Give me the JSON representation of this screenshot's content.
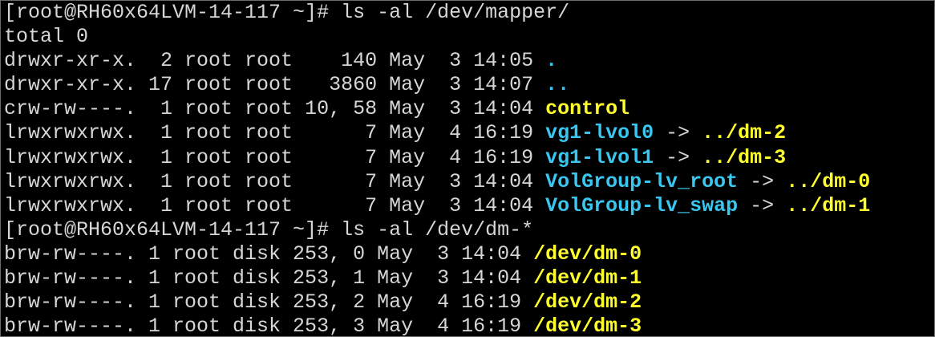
{
  "terminal": {
    "colors": {
      "background": "#000000",
      "text": "#d6d6d6",
      "cyan": "#39c7f0",
      "yellow": "#ffff2e"
    },
    "lines": [
      [
        {
          "text": "[root@RH60x64LVM-14-117 ~]# ls -al /dev/mapper/",
          "color": "default"
        }
      ],
      [
        {
          "text": "total 0",
          "color": "default"
        }
      ],
      [
        {
          "text": "drwxr-xr-x.  2 root root    140 May  3 14:05 ",
          "color": "default"
        },
        {
          "text": ".",
          "color": "cyan"
        }
      ],
      [
        {
          "text": "drwxr-xr-x. 17 root root   3860 May  3 14:07 ",
          "color": "default"
        },
        {
          "text": "..",
          "color": "cyan"
        }
      ],
      [
        {
          "text": "crw-rw----.  1 root root 10, 58 May  3 14:04 ",
          "color": "default"
        },
        {
          "text": "control",
          "color": "yellow"
        }
      ],
      [
        {
          "text": "lrwxrwxrwx.  1 root root      7 May  4 16:19 ",
          "color": "default"
        },
        {
          "text": "vg1-lvol0",
          "color": "cyan"
        },
        {
          "text": " -> ",
          "color": "default"
        },
        {
          "text": "../dm-2",
          "color": "yellow"
        }
      ],
      [
        {
          "text": "lrwxrwxrwx.  1 root root      7 May  4 16:19 ",
          "color": "default"
        },
        {
          "text": "vg1-lvol1",
          "color": "cyan"
        },
        {
          "text": " -> ",
          "color": "default"
        },
        {
          "text": "../dm-3",
          "color": "yellow"
        }
      ],
      [
        {
          "text": "lrwxrwxrwx.  1 root root      7 May  3 14:04 ",
          "color": "default"
        },
        {
          "text": "VolGroup-lv_root",
          "color": "cyan"
        },
        {
          "text": " -> ",
          "color": "default"
        },
        {
          "text": "../dm-0",
          "color": "yellow"
        }
      ],
      [
        {
          "text": "lrwxrwxrwx.  1 root root      7 May  3 14:04 ",
          "color": "default"
        },
        {
          "text": "VolGroup-lv_swap",
          "color": "cyan"
        },
        {
          "text": " -> ",
          "color": "default"
        },
        {
          "text": "../dm-1",
          "color": "yellow"
        }
      ],
      [
        {
          "text": "[root@RH60x64LVM-14-117 ~]# ls -al /dev/dm-*",
          "color": "default"
        }
      ],
      [
        {
          "text": "brw-rw----. 1 root disk 253, 0 May  3 14:04 ",
          "color": "default"
        },
        {
          "text": "/dev/dm-0",
          "color": "yellow"
        }
      ],
      [
        {
          "text": "brw-rw----. 1 root disk 253, 1 May  3 14:04 ",
          "color": "default"
        },
        {
          "text": "/dev/dm-1",
          "color": "yellow"
        }
      ],
      [
        {
          "text": "brw-rw----. 1 root disk 253, 2 May  4 16:19 ",
          "color": "default"
        },
        {
          "text": "/dev/dm-2",
          "color": "yellow"
        }
      ],
      [
        {
          "text": "brw-rw----. 1 root disk 253, 3 May  4 16:19 ",
          "color": "default"
        },
        {
          "text": "/dev/dm-3",
          "color": "yellow"
        }
      ]
    ]
  }
}
